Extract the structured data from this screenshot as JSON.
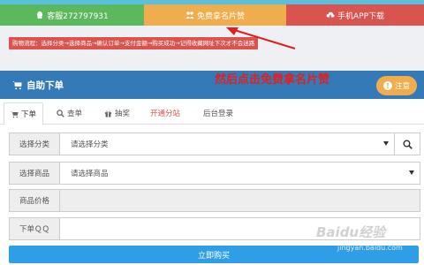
{
  "top_buttons": {
    "service": "客服272797931",
    "free_like": "免费拿名片赞",
    "app_download": "手机APP下载"
  },
  "flow_bar": "购物流程：选择分类→选择商品→确认订单→支付金额→购买成功→记得收藏网址下次才不会迷路",
  "panel": {
    "title": "自助下单",
    "notice": "注意"
  },
  "annotation": "然后点击免费拿名片赞",
  "tabs": {
    "order": "下单",
    "query": "查单",
    "lottery": "抽奖",
    "open_site": "开通分站",
    "admin": "后台登录"
  },
  "form": {
    "category_label": "选择分类",
    "category_value": "请选择分类",
    "product_label": "选择商品",
    "product_value": "请选择商品",
    "price_label": "商品价格",
    "price_value": "",
    "qq_label": "下单ＱＱ",
    "qq_value": ""
  },
  "submit_label": "立即购买",
  "watermark": {
    "logo": "Baidu经验",
    "url": "jingyan.baidu.com"
  },
  "colors": {
    "green": "#5cb85c",
    "orange": "#f0ad4e",
    "red": "#d9534f",
    "blue": "#337ab7",
    "submit": "#2e9fe6"
  }
}
